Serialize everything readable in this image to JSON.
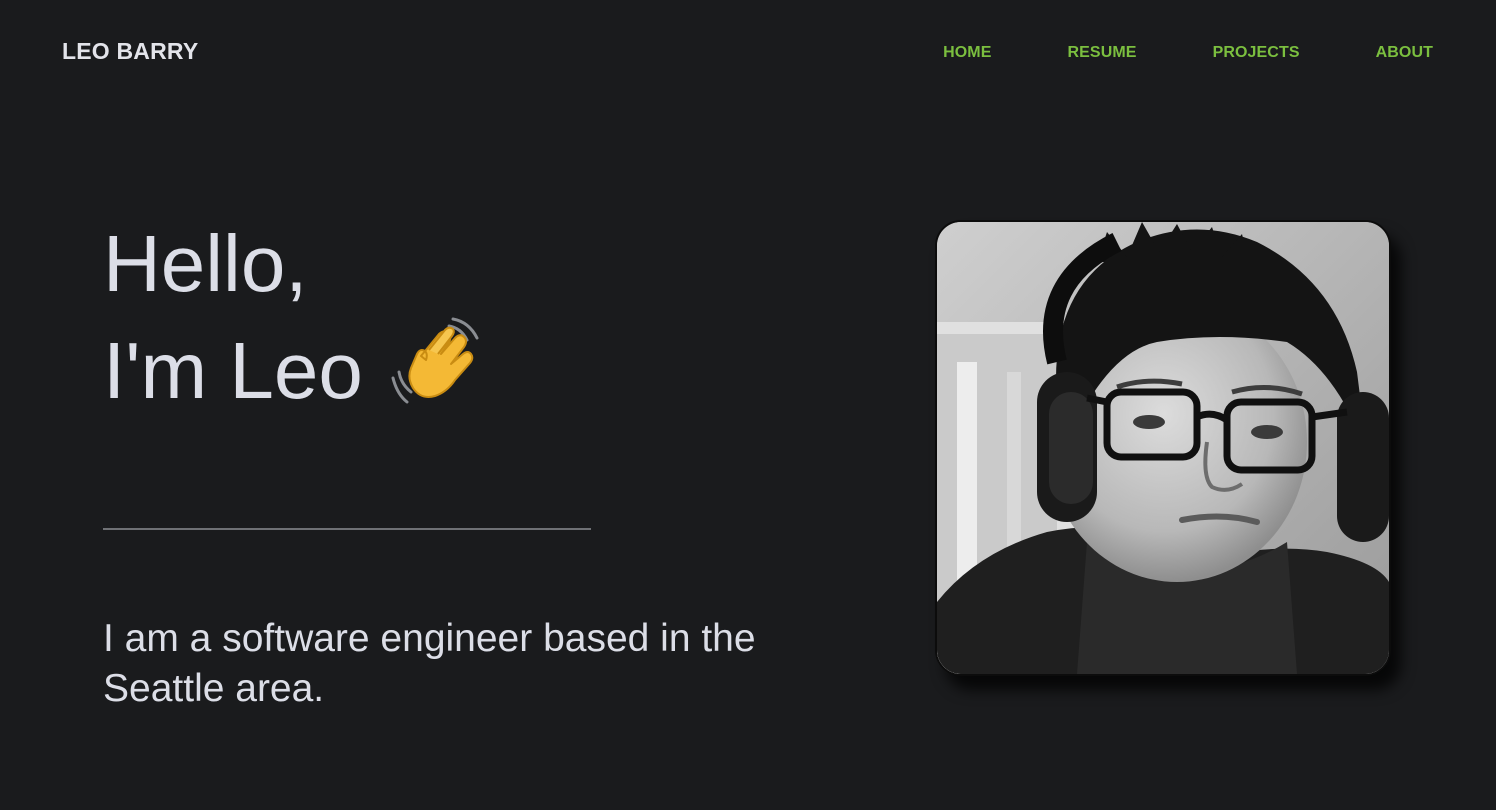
{
  "header": {
    "brand": "LEO BARRY",
    "nav": [
      {
        "label": "HOME"
      },
      {
        "label": "RESUME"
      },
      {
        "label": "PROJECTS"
      },
      {
        "label": "ABOUT"
      }
    ]
  },
  "hero": {
    "greeting_line1": "Hello,",
    "greeting_line2": "I'm Leo",
    "wave_icon": "waving-hand-emoji",
    "intro": "I am a software engineer based in the Seattle area."
  },
  "colors": {
    "background": "#1a1b1d",
    "accent": "#7bbf3f",
    "text": "#dcdee7"
  }
}
